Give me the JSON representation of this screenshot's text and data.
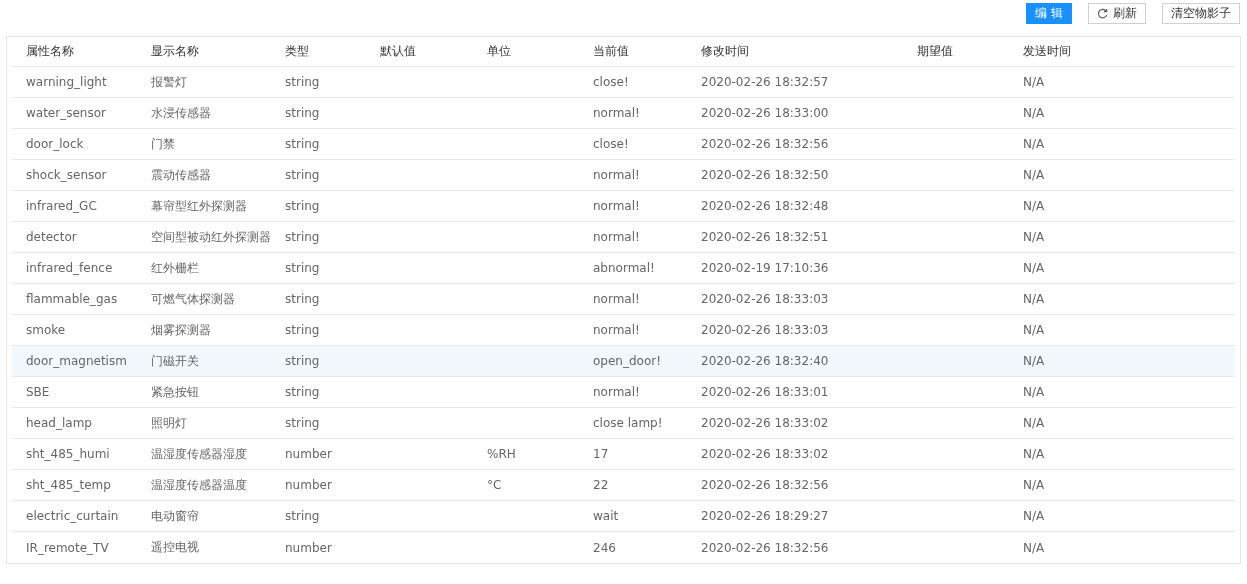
{
  "toolbar": {
    "buttons": [
      {
        "label": "编 辑",
        "kind": "primary"
      },
      {
        "label": "刷新",
        "kind": "refresh"
      },
      {
        "label": "清空物影子",
        "kind": "plain"
      }
    ]
  },
  "table": {
    "columns": [
      "属性名称",
      "显示名称",
      "类型",
      "默认值",
      "单位",
      "当前值",
      "修改时间",
      "期望值",
      "发送时间"
    ],
    "rows": [
      {
        "name": "warning_light",
        "display": "报警灯",
        "type": "string",
        "current": "close!",
        "modified": "2020-02-26 18:32:57",
        "sent": "N/A",
        "selected": false
      },
      {
        "name": "water_sensor",
        "display": "水浸传感器",
        "type": "string",
        "current": "normal!",
        "modified": "2020-02-26 18:33:00",
        "sent": "N/A",
        "selected": false
      },
      {
        "name": "door_lock",
        "display": "门禁",
        "type": "string",
        "current": "close!",
        "modified": "2020-02-26 18:32:56",
        "sent": "N/A",
        "selected": false
      },
      {
        "name": "shock_sensor",
        "display": "震动传感器",
        "type": "string",
        "current": "normal!",
        "modified": "2020-02-26 18:32:50",
        "sent": "N/A",
        "selected": false
      },
      {
        "name": "infrared_GC",
        "display": "幕帘型红外探测器",
        "type": "string",
        "current": "normal!",
        "modified": "2020-02-26 18:32:48",
        "sent": "N/A",
        "selected": false
      },
      {
        "name": "detector",
        "display": "空间型被动红外探测器",
        "type": "string",
        "current": "normal!",
        "modified": "2020-02-26 18:32:51",
        "sent": "N/A",
        "selected": false
      },
      {
        "name": "infrared_fence",
        "display": "红外栅栏",
        "type": "string",
        "current": "abnormal!",
        "modified": "2020-02-19 17:10:36",
        "sent": "N/A",
        "selected": false
      },
      {
        "name": "flammable_gas",
        "display": "可燃气体探测器",
        "type": "string",
        "current": "normal!",
        "modified": "2020-02-26 18:33:03",
        "sent": "N/A",
        "selected": false
      },
      {
        "name": "smoke",
        "display": "烟雾探测器",
        "type": "string",
        "current": "normal!",
        "modified": "2020-02-26 18:33:03",
        "sent": "N/A",
        "selected": false
      },
      {
        "name": "door_magnetism",
        "display": "门磁开关",
        "type": "string",
        "current": "open_door!",
        "modified": "2020-02-26 18:32:40",
        "sent": "N/A",
        "selected": true
      },
      {
        "name": "SBE",
        "display": "紧急按钮",
        "type": "string",
        "current": "normal!",
        "modified": "2020-02-26 18:33:01",
        "sent": "N/A",
        "selected": false
      },
      {
        "name": "head_lamp",
        "display": "照明灯",
        "type": "string",
        "current": "close lamp!",
        "modified": "2020-02-26 18:33:02",
        "sent": "N/A",
        "selected": false
      },
      {
        "name": "sht_485_humi",
        "display": "温湿度传感器湿度",
        "type": "number",
        "unit": "%RH",
        "current": "17",
        "modified": "2020-02-26 18:33:02",
        "sent": "N/A",
        "selected": false
      },
      {
        "name": "sht_485_temp",
        "display": "温湿度传感器温度",
        "type": "number",
        "unit": "°C",
        "current": "22",
        "modified": "2020-02-26 18:32:56",
        "sent": "N/A",
        "selected": false
      },
      {
        "name": "electric_curtain",
        "display": "电动窗帘",
        "type": "string",
        "current": "wait",
        "modified": "2020-02-26 18:29:27",
        "sent": "N/A",
        "selected": false
      },
      {
        "name": "IR_remote_TV",
        "display": "遥控电视",
        "type": "number",
        "current": "246",
        "modified": "2020-02-26 18:32:56",
        "sent": "N/A",
        "selected": false
      }
    ]
  }
}
